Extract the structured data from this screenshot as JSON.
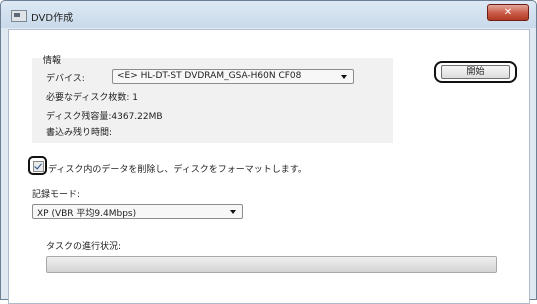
{
  "window": {
    "title": "DVD作成",
    "close_label": "✕"
  },
  "info": {
    "group_label": "情報",
    "device_label": "デバイス:",
    "device_value": "<E> HL-DT-ST DVDRAM_GSA-H60N CF08",
    "discs_needed": "必要なディスク枚数: 1",
    "disc_remaining": "ディスク残容量:4367.22MB",
    "write_time": "書込み残り時間:"
  },
  "start_button_label": "開始",
  "format_checkbox": {
    "checked": true,
    "label": "ディスク内のデータを削除し、ディスクをフォーマットします。"
  },
  "record_mode": {
    "label": "記録モード:",
    "value": "XP (VBR 平均9.4Mbps)"
  },
  "progress": {
    "label": "タスクの進行状況:",
    "value": 0
  },
  "icons": {
    "title": "dvd-app-icon",
    "close": "close-icon",
    "dropdown": "chevron-down-icon",
    "checkmark": "checkmark-icon"
  }
}
